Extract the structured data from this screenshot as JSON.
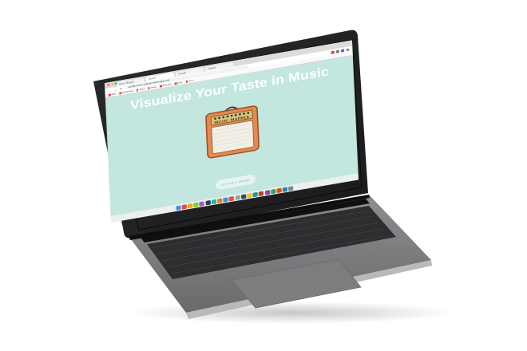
{
  "browser": {
    "tabs": [
      "Music Mapper",
      "Spotify",
      "Google",
      "GitHub"
    ],
    "url": "spotify-music-mapper.herokuapp.com",
    "bookmarks": [
      "Apps",
      "Bookmarks",
      "Slack",
      "Gmail",
      "Calendar",
      "Drive",
      "Docs"
    ]
  },
  "page": {
    "title": "Visualize Your Taste in Music",
    "amp_brand": "MUSIC MAPPER",
    "cta_label": "Let's see it, already!"
  },
  "colors": {
    "page_background": "#c3e6df",
    "title_text": "#ffffff",
    "amp_body": "#e8874f",
    "amp_grille": "#f3efe6"
  },
  "dock": {
    "icon_colors": [
      "#4a90e2",
      "#e94e3c",
      "#f5a623",
      "#7ed321",
      "#9b59b6",
      "#2c3e50",
      "#1abc9c",
      "#e67e22",
      "#3498db",
      "#e74c3c",
      "#95a5a6",
      "#34495e",
      "#f1c40f",
      "#16a085",
      "#c0392b",
      "#8e44ad",
      "#27ae60",
      "#d35400",
      "#2980b9",
      "#7f8c8d"
    ]
  }
}
